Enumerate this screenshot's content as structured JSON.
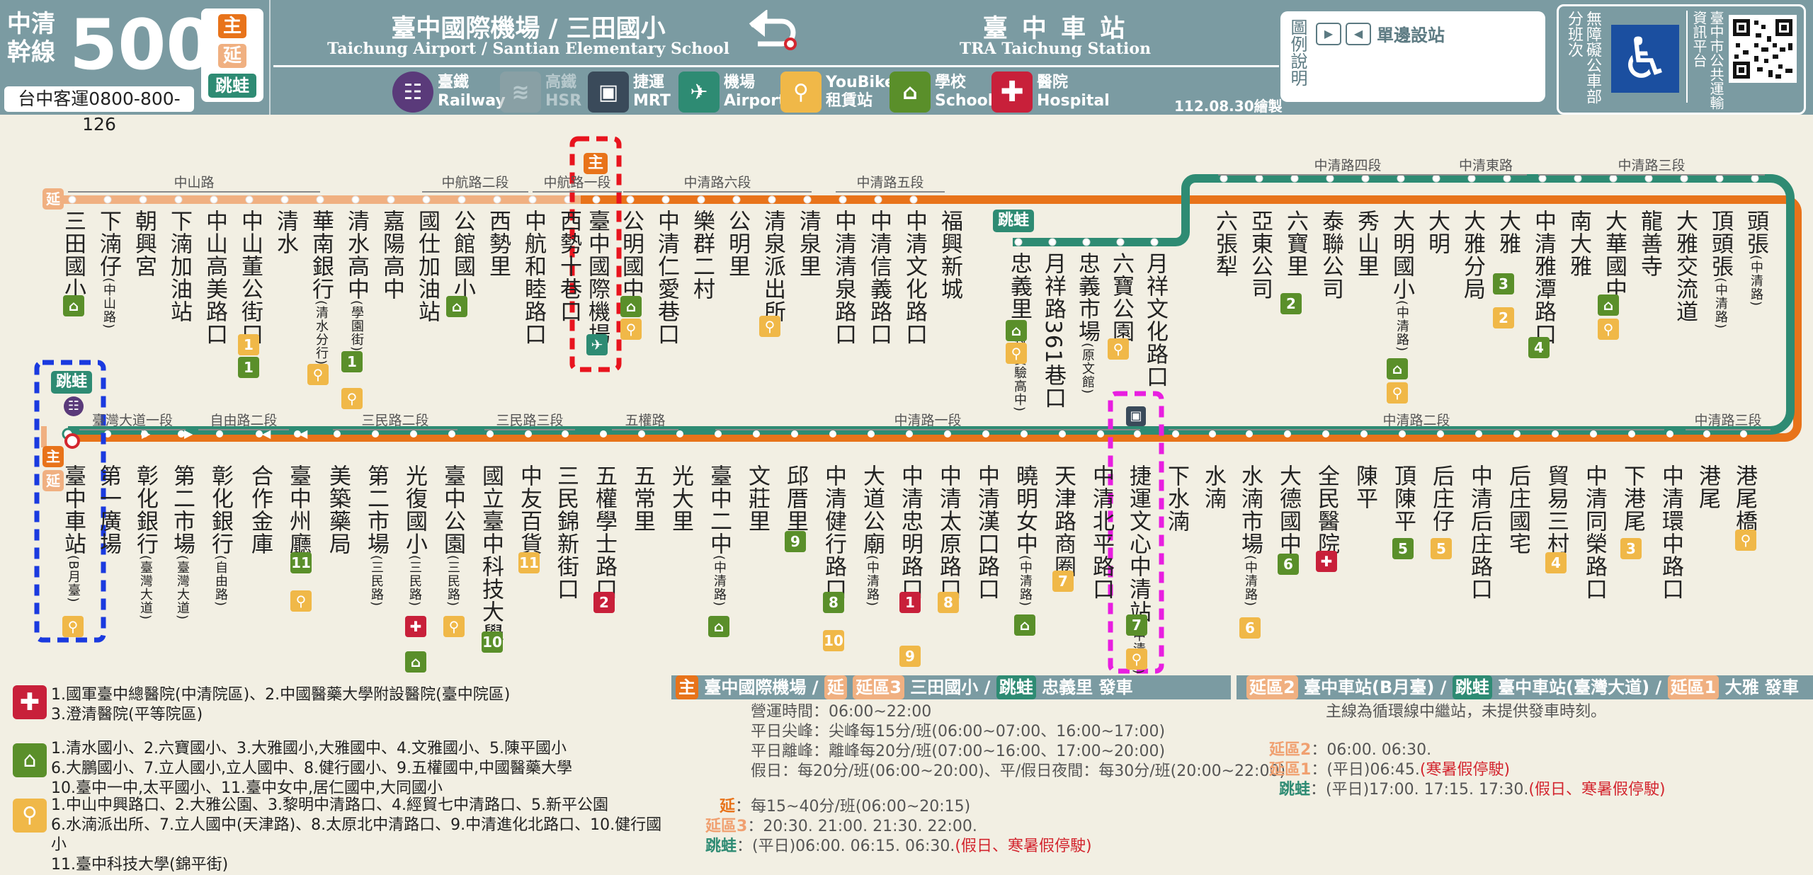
{
  "header": {
    "route_type_1": "中清",
    "route_type_2": "幹線",
    "route_number": "500",
    "operator": "台中客運0800-800-126",
    "legend_badges": [
      "主",
      "延",
      "跳蛙"
    ],
    "origin_zh": "臺中國際機場 / 三田國小",
    "origin_en": "Taichung Airport / Santian Elementary School",
    "destination_zh": "臺 中 車 站",
    "destination_en": "TRA Taichung Station",
    "legend_title": "圖例說明",
    "legend_oneway": "單邊設站",
    "accessible_label": "無障礙公車部分班次",
    "info_platform": "臺中市公共運輸資訊平台",
    "drawn_date": "112.08.30繪製",
    "facilities": [
      {
        "icon": "railway-icon",
        "zh": "臺鐵",
        "en": "Railway"
      },
      {
        "icon": "hsr-icon",
        "zh": "高鐵",
        "en": "HSR"
      },
      {
        "icon": "mrt-icon",
        "zh": "捷運",
        "en": "MRT"
      },
      {
        "icon": "airport-icon",
        "zh": "機場",
        "en": "Airport"
      },
      {
        "icon": "youbike-icon",
        "zh": "YouBike",
        "en": "租賃站"
      },
      {
        "icon": "school-icon",
        "zh": "學校",
        "en": "School"
      },
      {
        "icon": "hospital-icon",
        "zh": "醫院",
        "en": "Hospital"
      }
    ]
  },
  "colors": {
    "main": "#e8731a",
    "extended": "#f0b081",
    "frog": "#2e8b73",
    "header": "#7b9ba2"
  },
  "badges": {
    "main": "主",
    "ext": "延",
    "frog": "跳蛙"
  },
  "roads_top": [
    "中山路",
    "中航路二段",
    "中航路一段",
    "中清路六段",
    "中清路五段",
    "中清路四段",
    "中清東路",
    "中清路三段"
  ],
  "roads_bottom": [
    "臺灣大道一段",
    "自由路二段",
    "三民路二段",
    "三民路三段",
    "五權路",
    "中清路一段",
    "中清路二段",
    "中清路三段"
  ],
  "stations_top": [
    {
      "name": "三田國小",
      "sub": ""
    },
    {
      "name": "下湳仔",
      "sub": "(中山路)"
    },
    {
      "name": "朝興宮",
      "sub": ""
    },
    {
      "name": "下湳加油站",
      "sub": ""
    },
    {
      "name": "中山高美路口",
      "sub": ""
    },
    {
      "name": "中山董公街口",
      "sub": ""
    },
    {
      "name": "清水",
      "sub": ""
    },
    {
      "name": "華南銀行",
      "sub": "(清水分行)"
    },
    {
      "name": "清水高中",
      "sub": "(學園街)"
    },
    {
      "name": "嘉陽高中",
      "sub": ""
    },
    {
      "name": "國仕加油站",
      "sub": ""
    },
    {
      "name": "公館國小",
      "sub": ""
    },
    {
      "name": "西勢里",
      "sub": ""
    },
    {
      "name": "中航和睦路口",
      "sub": ""
    },
    {
      "name": "西勢十巷口",
      "sub": ""
    },
    {
      "name": "臺中國際機場",
      "sub": ""
    },
    {
      "name": "公明國中",
      "sub": ""
    },
    {
      "name": "中清仁愛巷口",
      "sub": ""
    },
    {
      "name": "樂群二村",
      "sub": ""
    },
    {
      "name": "公明里",
      "sub": ""
    },
    {
      "name": "清泉派出所",
      "sub": ""
    },
    {
      "name": "清泉里",
      "sub": ""
    },
    {
      "name": "中清清泉路口",
      "sub": ""
    },
    {
      "name": "中清信義路口",
      "sub": ""
    },
    {
      "name": "中清文化路口",
      "sub": ""
    },
    {
      "name": "福興新城",
      "sub": ""
    }
  ],
  "stations_frog": [
    {
      "name": "忠義里",
      "sub": "(中科實驗高中)"
    },
    {
      "name": "月祥路361巷口",
      "sub": ""
    },
    {
      "name": "忠義市場",
      "sub": "(原文館)"
    },
    {
      "name": "六寶公園",
      "sub": ""
    },
    {
      "name": "月祥文化路口",
      "sub": ""
    }
  ],
  "stations_top_right": [
    {
      "name": "六張犁",
      "sub": ""
    },
    {
      "name": "亞東公司",
      "sub": ""
    },
    {
      "name": "六寶里",
      "sub": ""
    },
    {
      "name": "泰聯公司",
      "sub": ""
    },
    {
      "name": "秀山里",
      "sub": ""
    },
    {
      "name": "大明國小",
      "sub": "(中清路)"
    },
    {
      "name": "大明",
      "sub": ""
    },
    {
      "name": "大雅分局",
      "sub": ""
    },
    {
      "name": "大雅",
      "sub": ""
    },
    {
      "name": "中清雅潭路口",
      "sub": ""
    },
    {
      "name": "南大雅",
      "sub": ""
    },
    {
      "name": "大華國中",
      "sub": ""
    },
    {
      "name": "龍善寺",
      "sub": ""
    },
    {
      "name": "大雅交流道",
      "sub": ""
    },
    {
      "name": "頂頭張",
      "sub": "(中清路)"
    },
    {
      "name": "頭張",
      "sub": "(中清路)"
    }
  ],
  "stations_bottom": [
    {
      "name": "臺中車站",
      "sub": "(B月臺)"
    },
    {
      "name": "第一廣場",
      "sub": ""
    },
    {
      "name": "彰化銀行",
      "sub": "(臺灣大道)"
    },
    {
      "name": "第二市場",
      "sub": "(臺灣大道)"
    },
    {
      "name": "彰化銀行",
      "sub": "(自由路)"
    },
    {
      "name": "合作金庫",
      "sub": ""
    },
    {
      "name": "臺中州廳",
      "sub": ""
    },
    {
      "name": "美築藥局",
      "sub": ""
    },
    {
      "name": "第二市場",
      "sub": "(三民路)"
    },
    {
      "name": "光復國小",
      "sub": "(三民路)"
    },
    {
      "name": "臺中公園",
      "sub": "(三民路)"
    },
    {
      "name": "國立臺中科技大學",
      "sub": ""
    },
    {
      "name": "中友百貨",
      "sub": ""
    },
    {
      "name": "三民錦新街口",
      "sub": ""
    },
    {
      "name": "五權學士路口",
      "sub": ""
    },
    {
      "name": "五常里",
      "sub": ""
    },
    {
      "name": "光大里",
      "sub": ""
    },
    {
      "name": "臺中二中",
      "sub": "(中清路)"
    },
    {
      "name": "文莊里",
      "sub": ""
    },
    {
      "name": "邱厝里",
      "sub": ""
    },
    {
      "name": "中清健行路口",
      "sub": ""
    },
    {
      "name": "大道公廟",
      "sub": "(中清路)"
    },
    {
      "name": "中清忠明路口",
      "sub": ""
    },
    {
      "name": "中清太原路口",
      "sub": ""
    },
    {
      "name": "中清漢口路口",
      "sub": ""
    },
    {
      "name": "曉明女中",
      "sub": "(中清路)"
    },
    {
      "name": "天津路商圈",
      "sub": ""
    },
    {
      "name": "中清北平路口",
      "sub": ""
    },
    {
      "name": "捷運文心中清站",
      "sub": "(中清路)"
    },
    {
      "name": "下水湳",
      "sub": ""
    },
    {
      "name": "水湳",
      "sub": ""
    },
    {
      "name": "水湳市場",
      "sub": "(中清路)"
    },
    {
      "name": "大德國中",
      "sub": ""
    },
    {
      "name": "全民醫院",
      "sub": ""
    },
    {
      "name": "陳平",
      "sub": ""
    },
    {
      "name": "頂陳平",
      "sub": ""
    },
    {
      "name": "后庄仔",
      "sub": ""
    },
    {
      "name": "中清后庄路口",
      "sub": ""
    },
    {
      "name": "后庄國宅",
      "sub": ""
    },
    {
      "name": "貿易三村",
      "sub": ""
    },
    {
      "name": "中清同榮路口",
      "sub": ""
    },
    {
      "name": "下港尾",
      "sub": ""
    },
    {
      "name": "中清環中路口",
      "sub": ""
    },
    {
      "name": "港尾",
      "sub": ""
    },
    {
      "name": "港尾橋",
      "sub": ""
    }
  ],
  "notes": {
    "hospitals": [
      "1.國軍臺中總醫院(中清院區)、2.中國醫藥大學附設醫院(臺中院區)",
      "3.澄清醫院(平等院區)"
    ],
    "schools": [
      "1.清水國小、2.六寶國小、3.大雅國小,大雅國中、4.文雅國小、5.陳平國小",
      "6.大鵬國小、7.立人國小,立人國中、8.健行國小、9.五權國中,中國醫藥大學",
      "10.臺中一中,太平國小、11.臺中女中,居仁國中,大同國小"
    ],
    "youbike": [
      "1.中山中興路口、2.大雅公園、3.黎明中清路口、4.經貿七中清路口、5.新平公園",
      "6.水湳派出所、7.立人國中(天津路)、8.太原北中清路口、9.中清進化北路口、10.健行國小",
      "11.臺中科技大學(錦平街)"
    ]
  },
  "schedule_mid": {
    "band": "臺中國際機場 / 延區3 三田國小 / 跳蛙 忠義里  發車",
    "band_b1": "主",
    "band_t1": "臺中國際機場 /",
    "band_b2": "延",
    "band_b3": "延區3",
    "band_t2": "三田國小 /",
    "band_b4": "跳蛙",
    "band_t3": "忠義里   發車",
    "lines": [
      "營運時間：06:00~22:00",
      "平日尖峰：尖峰每15分/班(06:00~07:00、16:00~17:00)",
      "平日離峰：離峰每20分/班(07:00~16:00、17:00~20:00)",
      "假日：每20分/班(06:00~20:00)、平/假日夜間：每30分/班(20:00~22:00)"
    ],
    "ext_label": "延",
    "ext_text": "：每15~40分/班(06:00~20:15)",
    "ext3_label": "延區3",
    "ext3_text": "：20:30. 21:00. 21:30. 22:00.",
    "frog_label": "跳蛙",
    "frog_text": "：(平日)06:00. 06:15. 06:30.",
    "frog_red": "(假日、寒暑假停駛)"
  },
  "schedule_right": {
    "band_b1": "延區2",
    "band_t1": "臺中車站(B月臺) /",
    "band_b2": "跳蛙",
    "band_t2": "臺中車站(臺灣大道) /",
    "band_b3": "延區1",
    "band_t3": "大雅    發車",
    "note": "主線為循環線中繼站，未提供發車時刻。",
    "ext2_label": "延區2",
    "ext2_text": "：06:00. 06:30.",
    "ext1_label": "延區1",
    "ext1_text": "：(平日)06:45.",
    "ext1_red": "(寒暑假停駛)",
    "frog_label": "跳蛙",
    "frog_text": "：(平日)17:00. 17:15. 17:30.",
    "frog_red": "(假日、寒暑假停駛)"
  }
}
